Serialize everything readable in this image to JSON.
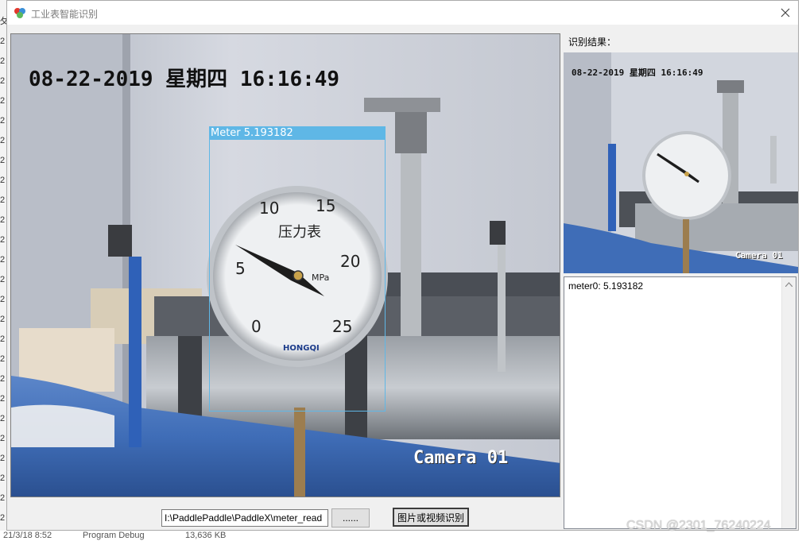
{
  "window": {
    "title": "工业表智能识别"
  },
  "background": {
    "left_fragments": [
      "攵",
      "2",
      "2",
      "2",
      "2",
      "2",
      "2",
      "2",
      "2",
      "2",
      "2",
      "2",
      "2",
      "2",
      "2",
      "2",
      "2",
      "2",
      "2",
      "2",
      "2",
      "2",
      "2",
      "2",
      "2",
      "2"
    ],
    "bottom": {
      "date": "21/3/18 8:52",
      "type": "Program Debug",
      "size": "13,636 KB"
    }
  },
  "video": {
    "timestamp": "08-22-2019 星期四 16:16:49",
    "camera_label": "Camera 01",
    "detection_label": "Meter 5.193182",
    "gauge": {
      "scale": [
        "0",
        "5",
        "10",
        "15",
        "20",
        "25"
      ],
      "title": "压力表",
      "unit": "MPa",
      "brand": "HONGQI"
    }
  },
  "controls": {
    "path_value": "I:\\PaddlePaddle\\PaddleX\\meter_read",
    "browse_label": "......",
    "detect_label": "图片或视频识别"
  },
  "result_panel": {
    "title": "识别结果：",
    "thumb_timestamp": "08-22-2019 星期四 16:16:49",
    "thumb_camera": "Camera 01",
    "result_text": "meter0: 5.193182"
  },
  "watermark": "CSDN @2301_76240224"
}
